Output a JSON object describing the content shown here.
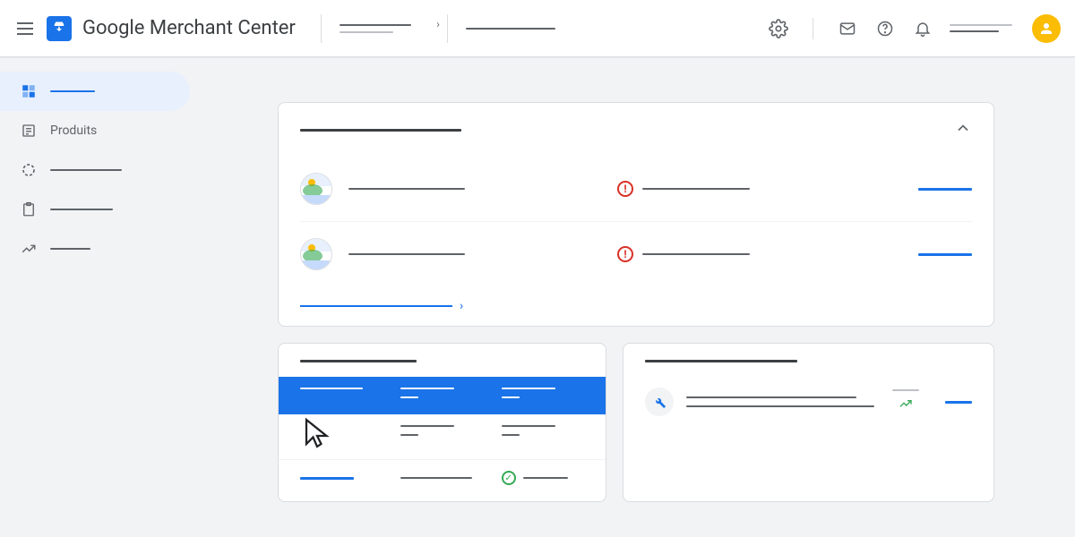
{
  "header": {
    "app_title": "Google Merchant Center"
  },
  "sidebar": {
    "items": [
      {
        "label": ""
      },
      {
        "label": "Produits"
      },
      {
        "label": ""
      },
      {
        "label": ""
      },
      {
        "label": ""
      }
    ]
  },
  "colors": {
    "primary": "#1a73e8",
    "danger": "#d93025",
    "success": "#34a853",
    "accent": "#fbbc04"
  }
}
